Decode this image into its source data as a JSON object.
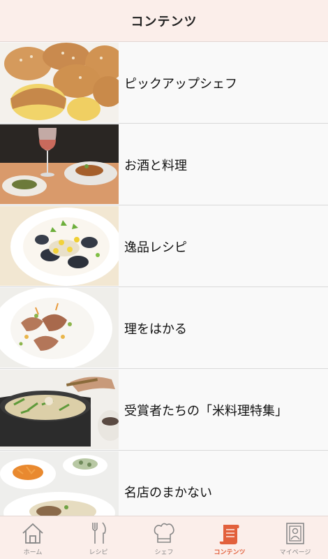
{
  "header": {
    "title": "コンテンツ"
  },
  "items": [
    {
      "label": "ピックアップシェフ",
      "image": "cream-puffs"
    },
    {
      "label": "お酒と料理",
      "image": "wine-and-dishes"
    },
    {
      "label": "逸品レシピ",
      "image": "mussel-pasta"
    },
    {
      "label": "理をはかる",
      "image": "plated-dish"
    },
    {
      "label": "受賞者たちの「米料理特集」",
      "image": "rice-pot"
    },
    {
      "label": "名店のまかない",
      "image": "carrot-salad-rice"
    }
  ],
  "tabs": [
    {
      "label": "ホーム",
      "icon": "home-icon",
      "active": false
    },
    {
      "label": "レシピ",
      "icon": "fork-knife-icon",
      "active": false
    },
    {
      "label": "シェフ",
      "icon": "chef-hat-icon",
      "active": false
    },
    {
      "label": "コンテンツ",
      "icon": "scroll-icon",
      "active": true
    },
    {
      "label": "マイページ",
      "icon": "profile-book-icon",
      "active": false
    }
  ],
  "colors": {
    "accent": "#e2603c",
    "header_bg": "#fbeeea"
  }
}
